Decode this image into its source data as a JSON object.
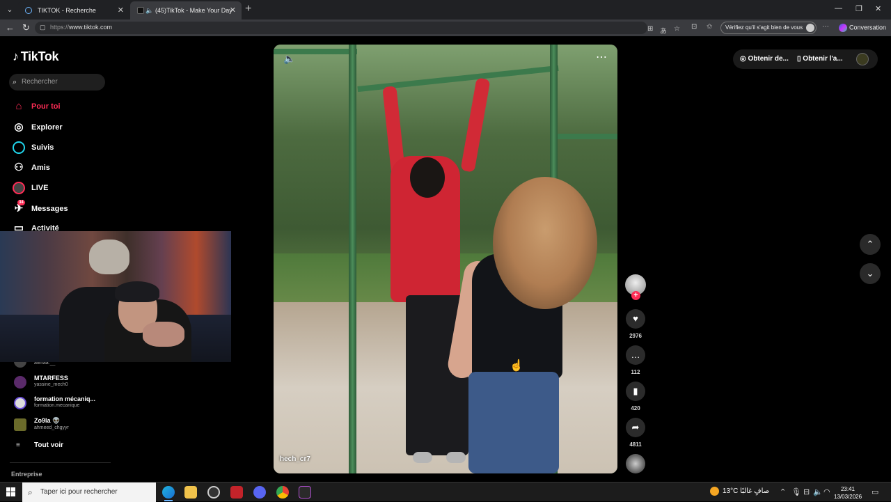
{
  "browser": {
    "tabs": [
      {
        "title": "TIKTOK - Recherche"
      },
      {
        "title": "(45)TikTok - Make Your Day"
      }
    ],
    "url_scheme": "https://",
    "url_host": "www.tiktok.com",
    "verify_label": "Vérifiez qu'il s'agit bien de vous",
    "conversation_label": "Conversation"
  },
  "tiktok": {
    "logo": "TikTok",
    "search_placeholder": "Rechercher",
    "nav": [
      {
        "label": "Pour toi",
        "icon": "home-icon"
      },
      {
        "label": "Explorer",
        "icon": "compass-icon"
      },
      {
        "label": "Suivis",
        "icon": "following-icon"
      },
      {
        "label": "Amis",
        "icon": "friends-icon"
      },
      {
        "label": "LIVE",
        "icon": "live-icon"
      },
      {
        "label": "Messages",
        "icon": "messages-icon",
        "badge": "34"
      },
      {
        "label": "Activité",
        "icon": "activity-icon"
      }
    ],
    "following_accounts": [
      {
        "name": "",
        "handle": "allmaa.__"
      },
      {
        "name": "MTARFESS",
        "handle": "yassine_mech0"
      },
      {
        "name": "formation mécaniq...",
        "handle": "formation.mecanique"
      },
      {
        "name": "Zo9la 👽",
        "handle": "ahmeed_chgyyr"
      }
    ],
    "see_all": "Tout voir",
    "entreprise": "Entreprise",
    "top_buttons": [
      {
        "label": "Obtenir de..."
      },
      {
        "label": "Obtenir l'a..."
      }
    ],
    "video": {
      "author": "hech_cr7",
      "likes": "2976",
      "comments": "112",
      "saves": "420",
      "shares": "4811"
    },
    "accent_color": "#fe2c55"
  },
  "taskbar": {
    "search_placeholder": "Taper ici pour rechercher",
    "weather": "13°C  صافٍ غالبًا",
    "time": "23:41",
    "date": "13/03/2026"
  }
}
